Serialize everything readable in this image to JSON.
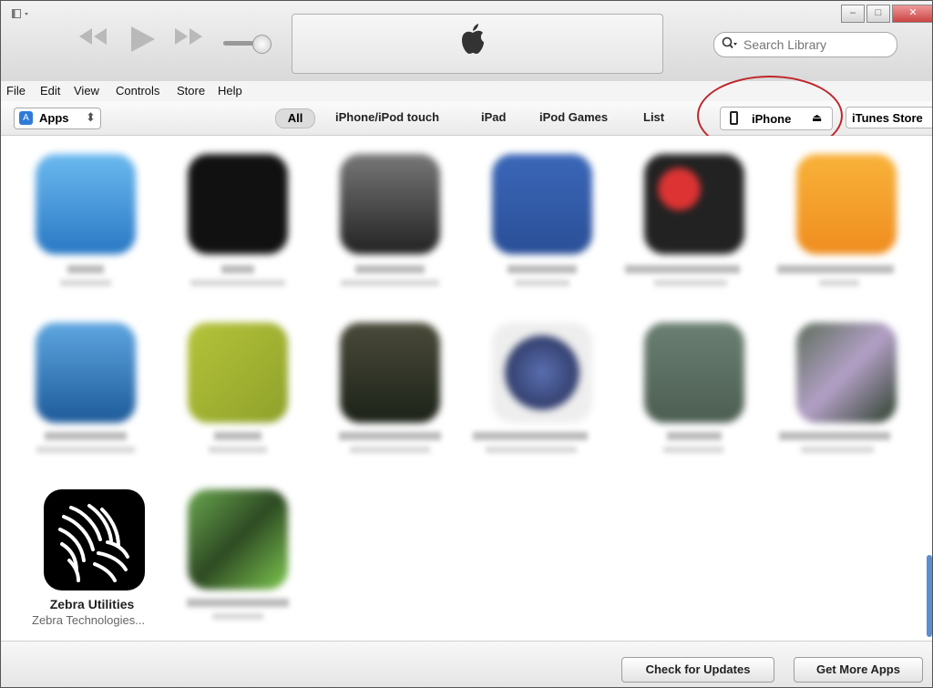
{
  "menu": [
    "File",
    "Edit",
    "View",
    "Controls",
    "Store",
    "Help"
  ],
  "search": {
    "placeholder": "Search Library"
  },
  "library": {
    "selector": "Apps"
  },
  "tabs": [
    "All",
    "iPhone/iPod touch",
    "iPad",
    "iPod Games",
    "List"
  ],
  "device": {
    "label": "iPhone"
  },
  "store": {
    "label": "iTunes Store"
  },
  "featured_app": {
    "name": "Zebra Utilities",
    "developer": "Zebra Technologies..."
  },
  "footer": {
    "check_updates": "Check for Updates",
    "get_more": "Get More Apps"
  },
  "colors": {
    "accent": "#2f7bd8",
    "highlight_circle": "#c0262b"
  },
  "icons": [
    "sidebar-toggle-icon",
    "rewind-icon",
    "play-icon",
    "fast-forward-icon",
    "apple-logo-icon",
    "search-icon",
    "phone-icon",
    "eject-icon",
    "app-store-icon",
    "zebra-logo-icon"
  ]
}
